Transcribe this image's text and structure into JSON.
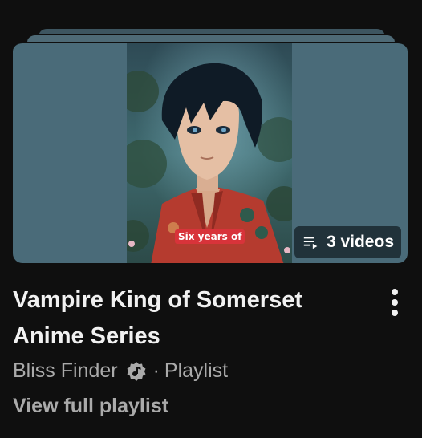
{
  "playlist": {
    "thumbnail_caption": "Six years of",
    "video_count": "3 videos",
    "title": "Vampire King of Somerset Anime Series",
    "channel": "Bliss Finder",
    "separator": "·",
    "type_label": "Playlist",
    "view_full_label": "View full playlist"
  },
  "icons": {
    "queue": "playlist-queue-icon",
    "verified": "verified-music-icon",
    "more": "more-vert-icon"
  },
  "colors": {
    "background": "#0f0f0f",
    "text_primary": "#f1f1f1",
    "text_secondary": "#aaaaaa",
    "thumb_bg": "#4a6b79",
    "caption_bg": "#d8333a"
  }
}
